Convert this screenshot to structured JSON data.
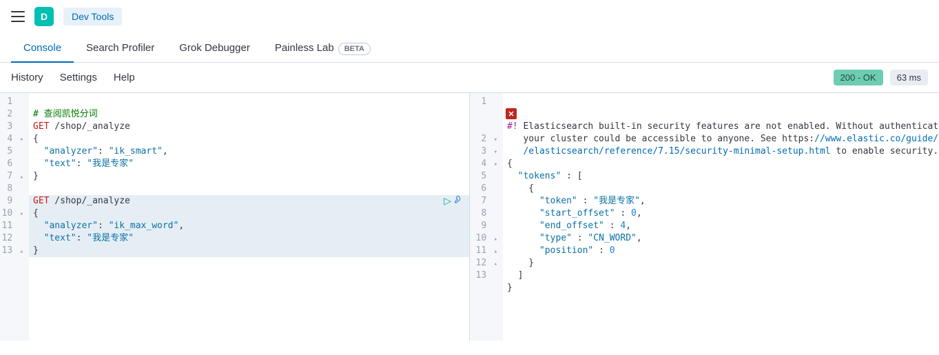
{
  "header": {
    "app_initial": "D",
    "app_name": "Dev Tools"
  },
  "tabs": [
    {
      "label": "Console",
      "active": true
    },
    {
      "label": "Search Profiler",
      "active": false
    },
    {
      "label": "Grok Debugger",
      "active": false
    },
    {
      "label": "Painless Lab",
      "active": false,
      "beta": "BETA"
    }
  ],
  "subnav": {
    "history": "History",
    "settings": "Settings",
    "help": "Help"
  },
  "status": {
    "code": "200 - OK",
    "time": "63 ms"
  },
  "request": {
    "lines": [
      {
        "n": "1",
        "arrow": "",
        "text": ""
      },
      {
        "n": "2",
        "arrow": "",
        "text": "# 查阅凯悦分词",
        "cls": "c"
      },
      {
        "n": "3",
        "arrow": "",
        "html": "<span class='m'>GET</span> /shop/_analyze"
      },
      {
        "n": "4",
        "arrow": "▾",
        "text": "{"
      },
      {
        "n": "5",
        "arrow": "",
        "html": "  <span class='s'>\"analyzer\"</span>: <span class='s'>\"ik_smart\"</span>,"
      },
      {
        "n": "6",
        "arrow": "",
        "html": "  <span class='s'>\"text\"</span>: <span class='s'>\"我是专家\"</span>"
      },
      {
        "n": "7",
        "arrow": "▴",
        "text": "}"
      },
      {
        "n": "8",
        "arrow": "",
        "text": ""
      },
      {
        "n": "9",
        "arrow": "",
        "html": "<span class='m'>GET</span> /shop/_analyze",
        "hl": true
      },
      {
        "n": "10",
        "arrow": "▾",
        "text": "{",
        "hl": true
      },
      {
        "n": "11",
        "arrow": "",
        "html": "  <span class='s'>\"analyzer\"</span>: <span class='s'>\"ik_max_word\"</span>,",
        "hl": true
      },
      {
        "n": "12",
        "arrow": "",
        "html": "  <span class='s'>\"text\"</span>: <span class='s'>\"我是专家\"</span>",
        "hl": true
      },
      {
        "n": "13",
        "arrow": "▴",
        "text": "}",
        "hl": true
      }
    ]
  },
  "response": {
    "lines": [
      {
        "n": "1",
        "arrow": "",
        "html": "<span class='k'>#!</span> Elasticsearch built-in security features are not enabled. Without authentication,",
        "wrap": true
      },
      {
        "n": "",
        "arrow": "",
        "html": "   your cluster could be accessible to anyone. See https:<span class='link'>//www.elastic.co/guide/en</span>"
      },
      {
        "n": "",
        "arrow": "",
        "html": "   <span class='link'>/elasticsearch/reference/7.15/security-minimal-setup.html</span> to enable security."
      },
      {
        "n": "2",
        "arrow": "▾",
        "text": "{"
      },
      {
        "n": "3",
        "arrow": "▾",
        "html": "  <span class='s'>\"tokens\"</span> : ["
      },
      {
        "n": "4",
        "arrow": "▾",
        "text": "    {"
      },
      {
        "n": "5",
        "arrow": "",
        "html": "      <span class='s'>\"token\"</span> : <span class='s'>\"我是专家\"</span>,"
      },
      {
        "n": "6",
        "arrow": "",
        "html": "      <span class='s'>\"start_offset\"</span> : <span class='n'>0</span>,"
      },
      {
        "n": "7",
        "arrow": "",
        "html": "      <span class='s'>\"end_offset\"</span> : <span class='n'>4</span>,"
      },
      {
        "n": "8",
        "arrow": "",
        "html": "      <span class='s'>\"type\"</span> : <span class='s'>\"CN_WORD\"</span>,"
      },
      {
        "n": "9",
        "arrow": "",
        "html": "      <span class='s'>\"position\"</span> : <span class='n'>0</span>"
      },
      {
        "n": "10",
        "arrow": "▴",
        "text": "    }"
      },
      {
        "n": "11",
        "arrow": "▴",
        "text": "  ]"
      },
      {
        "n": "12",
        "arrow": "▴",
        "text": "}"
      },
      {
        "n": "13",
        "arrow": "",
        "text": ""
      }
    ]
  }
}
